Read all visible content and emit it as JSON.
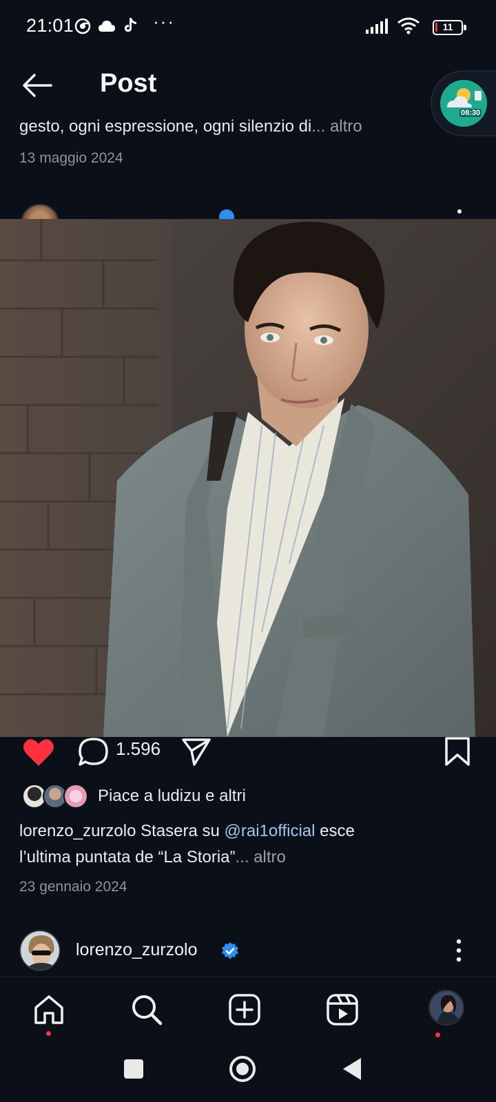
{
  "status_bar": {
    "time": "21:01",
    "dots": "···",
    "battery_level": "11",
    "icons": [
      "chrome-icon",
      "cloud-icon",
      "tiktok-icon",
      "signal-icon",
      "wifi-icon",
      "battery-icon"
    ]
  },
  "header": {
    "title": "Post",
    "widget_time": "08:30"
  },
  "previous_post": {
    "caption_text": "gesto, ogni espressione, ogni silenzio di",
    "caption_ellipsis": "...",
    "more_label": " altro",
    "date": "13 maggio 2024"
  },
  "post": {
    "comment_count": "1.596",
    "likes_text": "Piace a ludizu e altri",
    "caption_user": "lorenzo_zurzolo",
    "caption_before_mention": " Stasera su ",
    "caption_mention": "@rai1official",
    "caption_after_mention": " esce",
    "caption_line2": "l’ultima puntata de “La Storia”",
    "caption_ellipsis": "...",
    "more_label": " altro",
    "date": "23 gennaio 2024",
    "liked": true
  },
  "next_post": {
    "username": "lorenzo_zurzolo",
    "verified": true
  },
  "bottom_nav": {
    "items": [
      "home-icon",
      "search-icon",
      "create-icon",
      "reels-icon",
      "profile-avatar"
    ]
  },
  "colors": {
    "background": "#0b0f17",
    "like": "#ff3040",
    "mention": "#a8c3f0",
    "verified": "#2f8ff0",
    "secondary_text": "#8e949c"
  }
}
